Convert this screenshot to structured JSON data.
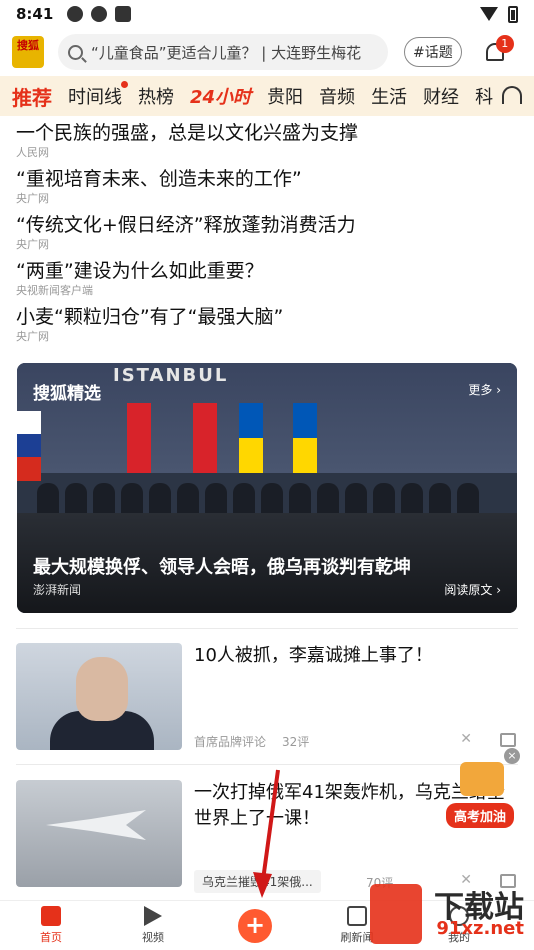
{
  "status_bar": {
    "time": "8:41"
  },
  "header": {
    "logo_text": "搜狐",
    "search_placeholder": "“儿童食品”更适合儿童？ | 大连野生梅花",
    "topic_label": "#话题",
    "notification_count": "1"
  },
  "tabs": [
    {
      "label": "推荐"
    },
    {
      "label": "时间线"
    },
    {
      "label": "热榜"
    },
    {
      "label": "24小时"
    },
    {
      "label": "贵阳"
    },
    {
      "label": "音频"
    },
    {
      "label": "生活"
    },
    {
      "label": "财经"
    },
    {
      "label": "科"
    }
  ],
  "headlines": [
    {
      "title": "一个民族的强盛，总是以文化兴盛为支撑",
      "source": "人民网"
    },
    {
      "title": "“重视培育未来、创造未来的工作”",
      "source": "央广网"
    },
    {
      "title": "“传统文化+假日经济”释放蓬勃消费活力",
      "source": "央广网"
    },
    {
      "title": "“两重”建设为什么如此重要？",
      "source": "央视新闻客户端"
    },
    {
      "title": "小麦“颗粒归仓”有了“最强大脑”",
      "source": "央广网"
    }
  ],
  "featured": {
    "tag": "搜狐精选",
    "more": "更多 ›",
    "image_text": "ISTANBUL",
    "title": "最大规模换俘、领导人会晤，俄乌再谈判有乾坤",
    "source": "澎湃新闻",
    "read_original": "阅读原文 ›"
  },
  "news": [
    {
      "title": "10人被抓，李嘉诚摊上事了！",
      "source": "首席品牌评论",
      "comments": "32评"
    },
    {
      "title": "一次打掉俄军41架轰炸机，乌克兰给全世界上了一课！",
      "related": "乌克兰摧毁41架俄...",
      "comments": "70评"
    }
  ],
  "float_ad": {
    "label": "高考加油",
    "close": "×"
  },
  "bottom_nav": [
    {
      "label": "首页"
    },
    {
      "label": "视频"
    },
    {
      "label": "+"
    },
    {
      "label": "刷新闻"
    },
    {
      "label": "我的"
    }
  ],
  "watermark": {
    "main": "下载站",
    "sub": "91xz.net"
  },
  "colors": {
    "accent": "#e5311a",
    "tab_bg": "#fbf1df"
  }
}
